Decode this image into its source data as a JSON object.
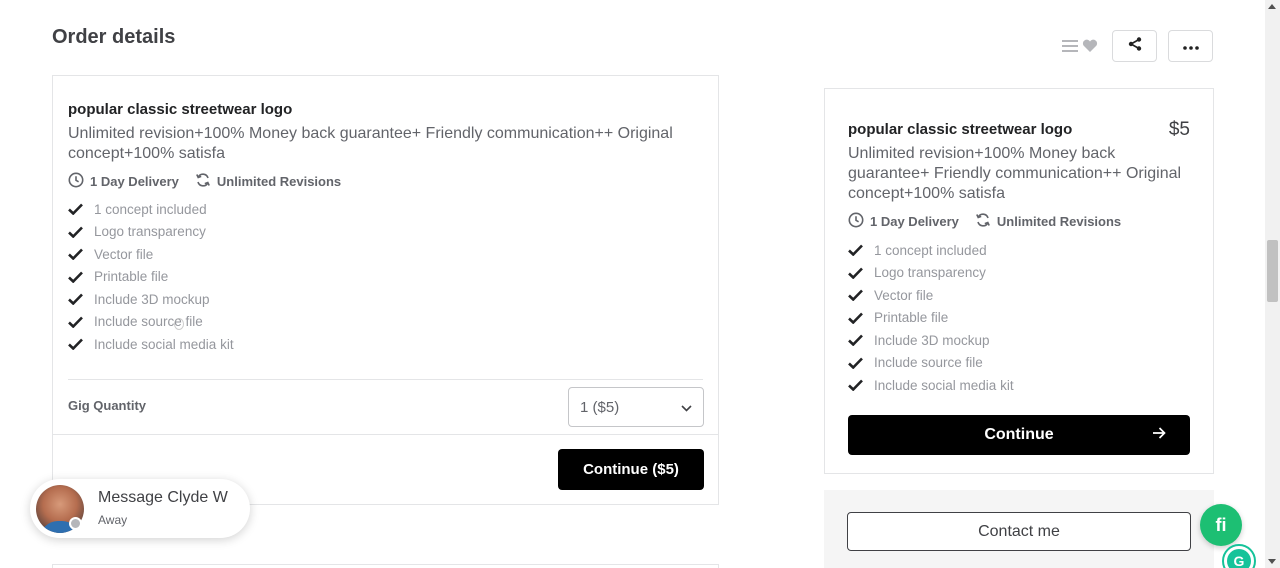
{
  "page": {
    "title": "Order details"
  },
  "top_actions": {
    "icons": [
      "list-icon",
      "heart-icon",
      "share-icon",
      "more-icon"
    ]
  },
  "order_card": {
    "package_title": "popular classic streetwear logo",
    "description": "Unlimited revision+100% Money back guarantee+ Friendly communication++ Original concept+100% satisfa",
    "delivery": "1 Day Delivery",
    "revisions": "Unlimited Revisions",
    "features": [
      "1 concept included",
      "Logo transparency",
      "Vector file",
      "Printable file",
      "Include 3D mockup",
      "Include source file",
      "Include social media kit"
    ],
    "quantity_label": "Gig Quantity",
    "quantity_value": "1 ($5)",
    "continue_label": "Continue ($5)"
  },
  "package_card": {
    "package_title": "popular classic streetwear logo",
    "price": "$5",
    "description": "Unlimited revision+100% Money back guarantee+ Friendly communication++ Original concept+100% satisfa",
    "delivery": "1 Day Delivery",
    "revisions": "Unlimited Revisions",
    "features": [
      "1 concept included",
      "Logo transparency",
      "Vector file",
      "Printable file",
      "Include 3D mockup",
      "Include source file",
      "Include social media kit"
    ],
    "continue_label": "Continue"
  },
  "contact": {
    "label": "Contact me"
  },
  "chat": {
    "name": "Message Clyde W",
    "status": "Away"
  },
  "fab": {
    "label": "fi"
  },
  "colors": {
    "accent": "#1dbf73",
    "primary_button": "#000000",
    "text": "#404145",
    "muted": "#95979d"
  }
}
